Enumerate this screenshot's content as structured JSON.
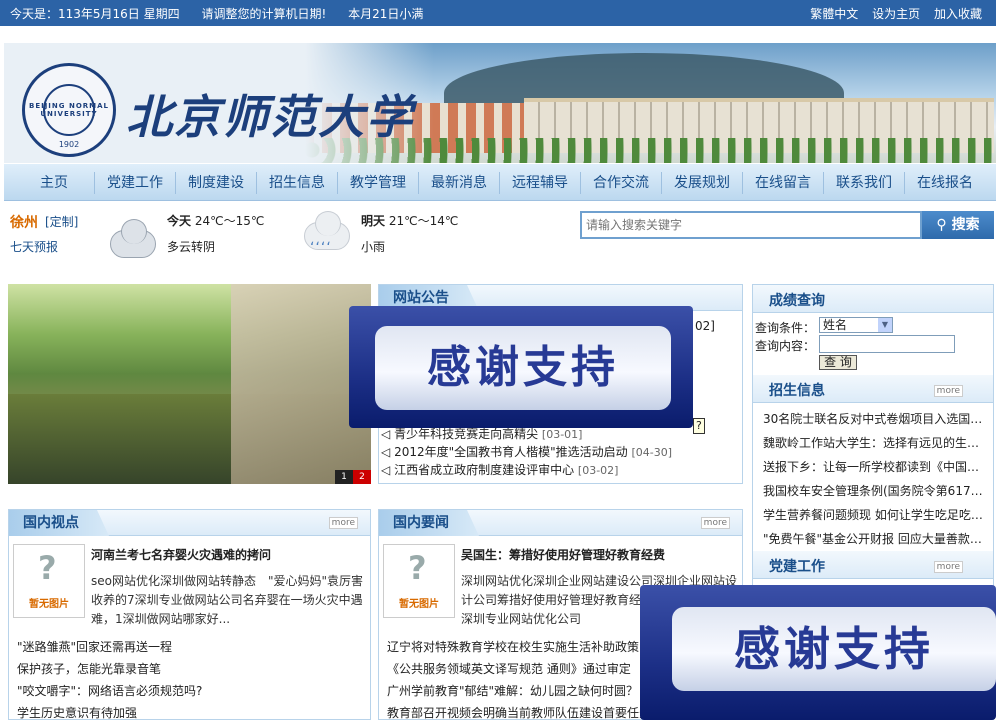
{
  "topbar": {
    "date": "今天是：113年5月16日  星期四",
    "notice": "请调整您的计算机日期!",
    "solar_term": "本月21日小满",
    "links": [
      "繁體中文",
      "设为主页",
      "加入收藏"
    ]
  },
  "header": {
    "seal_text": "BEIJING NORMAL UNIVERSITY",
    "seal_year": "1902",
    "logo": "北京师范大学"
  },
  "nav": [
    "主页",
    "党建工作",
    "制度建设",
    "招生信息",
    "教学管理",
    "最新消息",
    "远程辅导",
    "合作交流",
    "发展规划",
    "在线留言",
    "联系我们",
    "在线报名"
  ],
  "weather": {
    "city": "徐州",
    "edit": "[定制]",
    "seven_day": "七天预报",
    "today_label": "今天",
    "today_temp": "24℃～15℃",
    "today_desc": "多云转阴",
    "tomorrow_label": "明天",
    "tomorrow_temp": "21℃～14℃",
    "tomorrow_desc": "小雨"
  },
  "search": {
    "placeholder": "请输入搜索关键字",
    "button": "搜索"
  },
  "slideshow": {
    "pages": [
      "1",
      "2"
    ]
  },
  "notice": {
    "title": "网站公告",
    "partial_date": "02]",
    "items": [
      {
        "text": "青少年科技竞赛走向高精尖",
        "date": "[03-01]"
      },
      {
        "text": "2012年度\"全国教书育人楷模\"推选活动启动",
        "date": "[04-30]"
      },
      {
        "text": "江西省成立政府制度建设评审中心",
        "date": "[03-02]"
      }
    ],
    "tooltip": "?"
  },
  "ads": {
    "text": "感谢支持"
  },
  "score_query": {
    "title": "成绩查询",
    "cond_label": "查询条件：",
    "cond_value": "姓名",
    "content_label": "查询内容：",
    "button": "查 询"
  },
  "admission": {
    "title": "招生信息",
    "more": "more",
    "items": [
      "30名院士联名反对中式卷烟项目入选国…",
      "魏歌岭工作站大学生：选择有远见的生…",
      "送报下乡：让每一所学校都读到《中国…",
      "我国校车安全管理条例(国务院令第617…",
      "学生营养餐问题频现 如何让学生吃足吃…",
      "\"免费午餐\"基金公开财报 回应大量善款…"
    ]
  },
  "party": {
    "title": "党建工作",
    "more": "more"
  },
  "domestic_view": {
    "title": "国内视点",
    "more": "more",
    "thumb_label": "暂无图片",
    "feature_title": "河南兰考七名弃婴火灾遇难的拷问",
    "feature_summary": "seo网站优化深圳做网站转静态　\"爱心妈妈\"袁厉害收养的7深圳专业做网站公司名弃婴在一场火灾中遇难，1深圳做网站哪家好...",
    "items": [
      "\"迷路雏燕\"回家还需再送一程",
      "保护孩子，怎能光靠录音笔",
      "\"咬文嚼字\"：网络语言必须规范吗?",
      "学生历史意识有待加强"
    ]
  },
  "domestic_news": {
    "title": "国内要闻",
    "more": "more",
    "thumb_label": "暂无图片",
    "feature_title": "吴国生：筹措好使用好管理好教育经费",
    "feature_summary": "深圳网站优化深圳企业网站建设公司深圳企业网站设计公司筹措好使用好管理好教育经费化网站优化排名深圳专业网站优化公司",
    "items": [
      "辽宁将对特殊教育学校在校生实施生活补助政策",
      "《公共服务领域英文译写规范 通则》通过审定",
      "广州学前教育\"郁结\"难解：幼儿园之缺何时圆？",
      "教育部召开视频会明确当前教师队伍建设首要任务"
    ]
  }
}
